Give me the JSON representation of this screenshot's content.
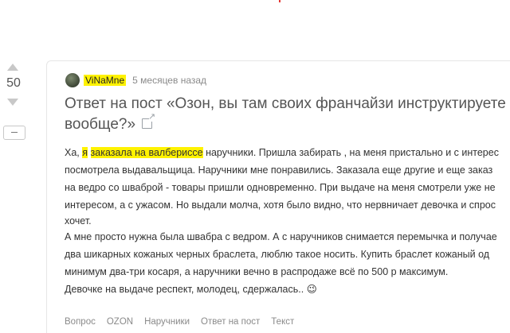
{
  "vote": {
    "count": "50"
  },
  "post": {
    "author": "ViNaMne",
    "time": "5 месяцев назад",
    "title": "Ответ на пост «Озон, вы там своих франчайзи инструктируете вообще?»",
    "body": {
      "l1_a": "Ха, ",
      "l1_hl1": "я",
      "l1_b": " ",
      "l1_hl2": "заказала на валберисce",
      "l1_c": " наручники. Пришла забирать , на меня пристально и с интерес",
      "l2": "посмотрела выдавальщица. Наручники мне понравились. Заказала еще другие и еще заказ",
      "l3": "на ведро со шваброй - товары пришли одновременно. При выдаче на меня смотрели уже не",
      "l4": "интересом, а с ужасом. Но выдали молча, хотя было видно, что нервничает девочка и спрос",
      "l5": "хочет.",
      "l6": "А мне просто нужна была швабра с ведром. А с наручников снимается перемычка и получае",
      "l7": "два шикарных кожаных черных браслета, люблю такое носить. Купить браслет кожаный од",
      "l8": "минимум два-три косаря, а наручники вечно в распродаже всё по 500 р максимум.",
      "l9": "Девочке на выдаче респект, молодец, сдержалась.. 😉"
    },
    "tags": [
      "Вопрос",
      "OZON",
      "Наручники",
      "Ответ на пост",
      "Текст"
    ]
  },
  "colors": {
    "highlight": "#fff200",
    "muted": "#8a8a8a",
    "title": "#555555"
  }
}
